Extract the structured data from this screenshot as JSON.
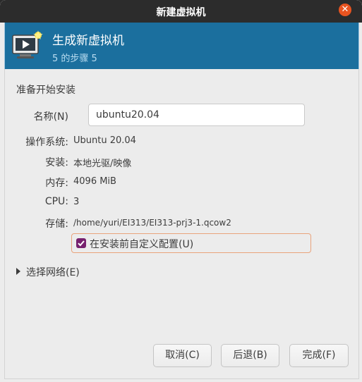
{
  "window": {
    "title": "新建虚拟机"
  },
  "header": {
    "title": "生成新虚拟机",
    "step": "5 的步骤 5"
  },
  "content": {
    "section_title": "准备开始安装",
    "name_label": "名称(N)",
    "name_value": "ubuntu20.04",
    "os_label": "操作系统:",
    "os_value": "Ubuntu 20.04",
    "install_label": "安装:",
    "install_value": "本地光驱/映像",
    "memory_label": "内存:",
    "memory_value": "4096 MiB",
    "cpu_label": "CPU:",
    "cpu_value": "3",
    "storage_label": "存储:",
    "storage_value": "/home/yuri/EI313/EI313-prj3-1.qcow2",
    "customize_label": "在安装前自定义配置(U)",
    "customize_checked": true,
    "network_label": "选择网络(E)"
  },
  "buttons": {
    "cancel": "取消(C)",
    "back": "后退(B)",
    "finish": "完成(F)"
  },
  "icons": {
    "close": "close-icon",
    "header": "virtual-machine-monitor-icon",
    "checkbox": "check-icon",
    "expander": "triangle-right-icon"
  },
  "colors": {
    "titlebar": "#2c2c2c",
    "header_bg": "#1b6f9e",
    "close_btn": "#e95420",
    "checkbox": "#77216f",
    "focus_border": "#e9a37b"
  }
}
